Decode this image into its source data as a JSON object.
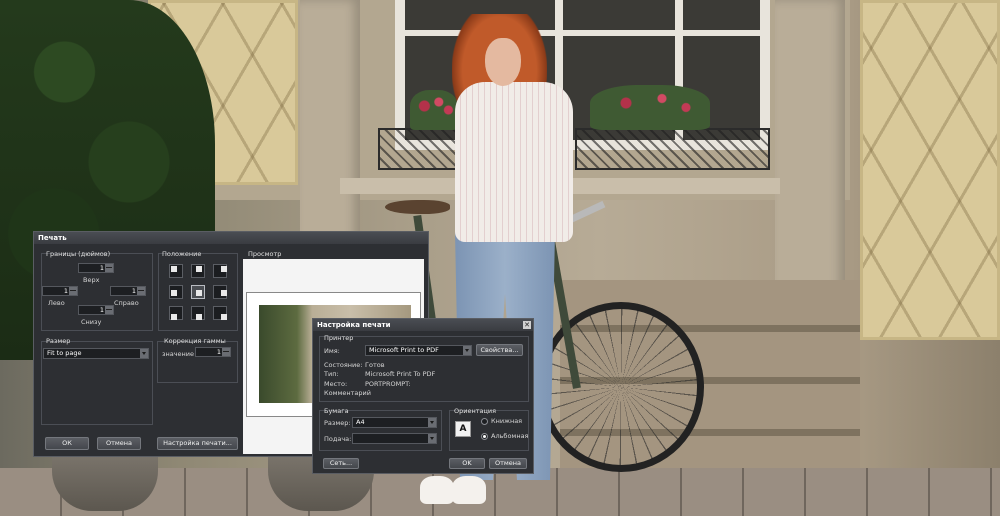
{
  "print_dialog": {
    "title": "Печать",
    "margins": {
      "title": "Границы (дюймов)",
      "top_label": "Верх",
      "left_label": "Лево",
      "right_label": "Справо",
      "bottom_label": "Снизу",
      "top_value": "1",
      "left_value": "1",
      "right_value": "1",
      "bottom_value": "1"
    },
    "position": {
      "title": "Положение",
      "selected": "center"
    },
    "preview": {
      "title": "Просмотр"
    },
    "size": {
      "title": "Размер",
      "value": "Fit to page"
    },
    "gamma": {
      "title": "Коррекция гаммы",
      "value_label": "значение",
      "value": "1"
    },
    "buttons": {
      "ok": "ОК",
      "cancel": "Отмена",
      "page_setup": "Настройка печати..."
    }
  },
  "page_setup_dialog": {
    "title": "Настройка печати",
    "printer": {
      "title": "Принтер",
      "name_label": "Имя:",
      "name_value": "Microsoft Print to PDF",
      "properties_button": "Свойства...",
      "status_label": "Состояние:",
      "status_value": "Готов",
      "type_label": "Тип:",
      "type_value": "Microsoft Print To PDF",
      "where_label": "Место:",
      "where_value": "PORTPROMPT:",
      "comment_label": "Комментарий"
    },
    "paper": {
      "title": "Бумага",
      "size_label": "Размер:",
      "size_value": "A4",
      "source_label": "Подача:",
      "source_value": ""
    },
    "orientation": {
      "title": "Ориентация",
      "portrait": "Книжная",
      "landscape": "Альбомная",
      "selected": "landscape"
    },
    "buttons": {
      "network": "Сеть...",
      "ok": "OK",
      "cancel": "Отмена"
    }
  },
  "colors": {
    "dialog_bg": "#2d2f33",
    "titlebar": "#3a3c41",
    "border": "#5a5d63"
  }
}
